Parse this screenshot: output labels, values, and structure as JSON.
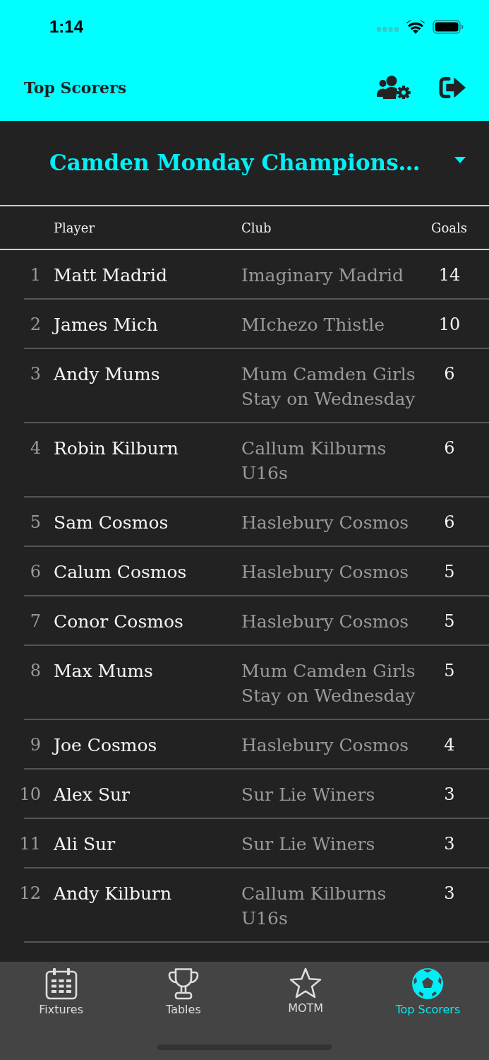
{
  "status_bar": {
    "time": "1:14"
  },
  "header": {
    "title": "Top Scorers"
  },
  "league_selector": {
    "value": "Camden Monday Champions…"
  },
  "table": {
    "columns": [
      "Player",
      "Club",
      "Goals"
    ],
    "rows": [
      {
        "rank": "1",
        "player": "Matt Madrid",
        "club": "Imaginary Madrid",
        "goals": "14"
      },
      {
        "rank": "2",
        "player": "James Mich",
        "club": "MIchezo Thistle",
        "goals": "10"
      },
      {
        "rank": "3",
        "player": "Andy Mums",
        "club": "Mum Camden Girls Stay on Wednesday",
        "goals": "6"
      },
      {
        "rank": "4",
        "player": "Robin Kilburn",
        "club": "Callum Kilburns U16s",
        "goals": "6"
      },
      {
        "rank": "5",
        "player": "Sam Cosmos",
        "club": "Haslebury Cosmos",
        "goals": "6"
      },
      {
        "rank": "6",
        "player": "Calum Cosmos",
        "club": "Haslebury Cosmos",
        "goals": "5"
      },
      {
        "rank": "7",
        "player": "Conor Cosmos",
        "club": "Haslebury Cosmos",
        "goals": "5"
      },
      {
        "rank": "8",
        "player": "Max Mums",
        "club": "Mum Camden Girls Stay on Wednesday",
        "goals": "5"
      },
      {
        "rank": "9",
        "player": "Joe Cosmos",
        "club": "Haslebury Cosmos",
        "goals": "4"
      },
      {
        "rank": "10",
        "player": "Alex Sur",
        "club": "Sur Lie Winers",
        "goals": "3"
      },
      {
        "rank": "11",
        "player": "Ali Sur",
        "club": "Sur Lie Winers",
        "goals": "3"
      },
      {
        "rank": "12",
        "player": "Andy Kilburn",
        "club": "Callum Kilburns U16s",
        "goals": "3"
      }
    ]
  },
  "tabs": [
    {
      "label": "Fixtures",
      "selected": false
    },
    {
      "label": "Tables",
      "selected": false
    },
    {
      "label": "MOTM",
      "selected": false
    },
    {
      "label": "Top Scorers",
      "selected": true
    }
  ]
}
